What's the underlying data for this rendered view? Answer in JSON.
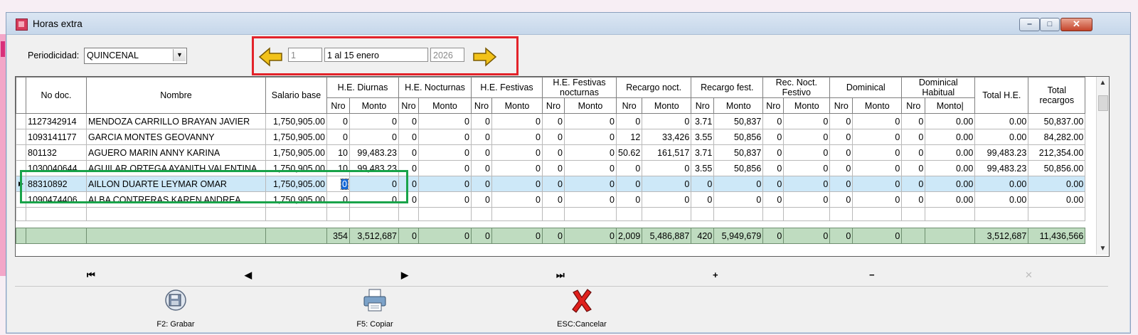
{
  "window": {
    "title": "Horas extra",
    "min_glyph": "‒",
    "max_glyph": "□",
    "close_glyph": "✕"
  },
  "filters": {
    "periodicidad_label": "Periodicidad:",
    "periodicidad_value": "QUINCENAL",
    "period_number": "1",
    "period_description": "1 al 15 enero",
    "year": "2026"
  },
  "grid": {
    "headers": {
      "no_doc": "No doc.",
      "nombre": "Nombre",
      "salario_base": "Salario base",
      "groups": [
        "H.E. Diurnas",
        "H.E. Nocturnas",
        "H.E. Festivas",
        "H.E. Festivas nocturnas",
        "Recargo noct.",
        "Recargo fest.",
        "Rec. Noct. Festivo",
        "Dominical",
        "Dominical Habitual"
      ],
      "sub_nro": "Nro",
      "sub_monto": "Monto",
      "last_monto": "Monto|",
      "total_he": "Total H.E.",
      "total_recargos": "Total recargos"
    },
    "rows": [
      [
        "1127342914",
        "MENDOZA CARRILLO BRAYAN JAVIER",
        "1,750,905.00",
        "0",
        "0",
        "0",
        "0",
        "0",
        "0",
        "0",
        "0",
        "0",
        "0",
        "3.71",
        "50,837",
        "0",
        "0",
        "0",
        "0",
        "0",
        "0.00",
        "0.00",
        "50,837.00"
      ],
      [
        "1093141177",
        "GARCIA MONTES GEOVANNY",
        "1,750,905.00",
        "0",
        "0",
        "0",
        "0",
        "0",
        "0",
        "0",
        "0",
        "12",
        "33,426",
        "3.55",
        "50,856",
        "0",
        "0",
        "0",
        "0",
        "0",
        "0.00",
        "0.00",
        "84,282.00"
      ],
      [
        "801132",
        "AGUERO MARIN ANNY KARINA",
        "1,750,905.00",
        "10",
        "99,483.23",
        "0",
        "0",
        "0",
        "0",
        "0",
        "0",
        "50.62",
        "161,517",
        "3.71",
        "50,837",
        "0",
        "0",
        "0",
        "0",
        "0",
        "0.00",
        "99,483.23",
        "212,354.00"
      ],
      [
        "1030040644",
        "AGUILAR ORTEGA AYANITH VALENTINA",
        "1,750,905.00",
        "10",
        "99,483.23",
        "0",
        "0",
        "0",
        "0",
        "0",
        "0",
        "0",
        "0",
        "3.55",
        "50,856",
        "0",
        "0",
        "0",
        "0",
        "0",
        "0.00",
        "99,483.23",
        "50,856.00"
      ],
      [
        "88310892",
        "AILLON DUARTE LEYMAR OMAR",
        "1,750,905.00",
        "0",
        "0",
        "0",
        "0",
        "0",
        "0",
        "0",
        "0",
        "0",
        "0",
        "0",
        "0",
        "0",
        "0",
        "0",
        "0",
        "0",
        "0.00",
        "0.00",
        "0.00"
      ],
      [
        "1090474406",
        "ALBA CONTRERAS KAREN ANDREA",
        "1,750,905.00",
        "0",
        "0",
        "0",
        "0",
        "0",
        "0",
        "0",
        "0",
        "0",
        "0",
        "0",
        "0",
        "0",
        "0",
        "0",
        "0",
        "0",
        "0.00",
        "0.00",
        "0.00"
      ]
    ],
    "current_row_indicator": "▶",
    "totals": [
      "",
      "",
      "",
      "354",
      "3,512,687",
      "0",
      "0",
      "0",
      "0",
      "0",
      "0",
      "2,009",
      "5,486,887",
      "420",
      "5,949,679",
      "0",
      "0",
      "0",
      "0",
      "",
      "",
      "3,512,687",
      "11,436,566"
    ]
  },
  "navigator": {
    "first": "⏮",
    "prev": "◀",
    "next": "▶",
    "last": "⏭",
    "add": "+",
    "remove": "−",
    "cancel_edit": "✕"
  },
  "actions": {
    "save": "F2: Grabar",
    "copy": "F5: Copiar",
    "cancel": "ESC:Cancelar"
  },
  "colors": {
    "red_highlight": "#e3232a",
    "green_highlight": "#19a34a",
    "totals_row": "#bfdcc0",
    "selected_row": "#cde8f8"
  }
}
